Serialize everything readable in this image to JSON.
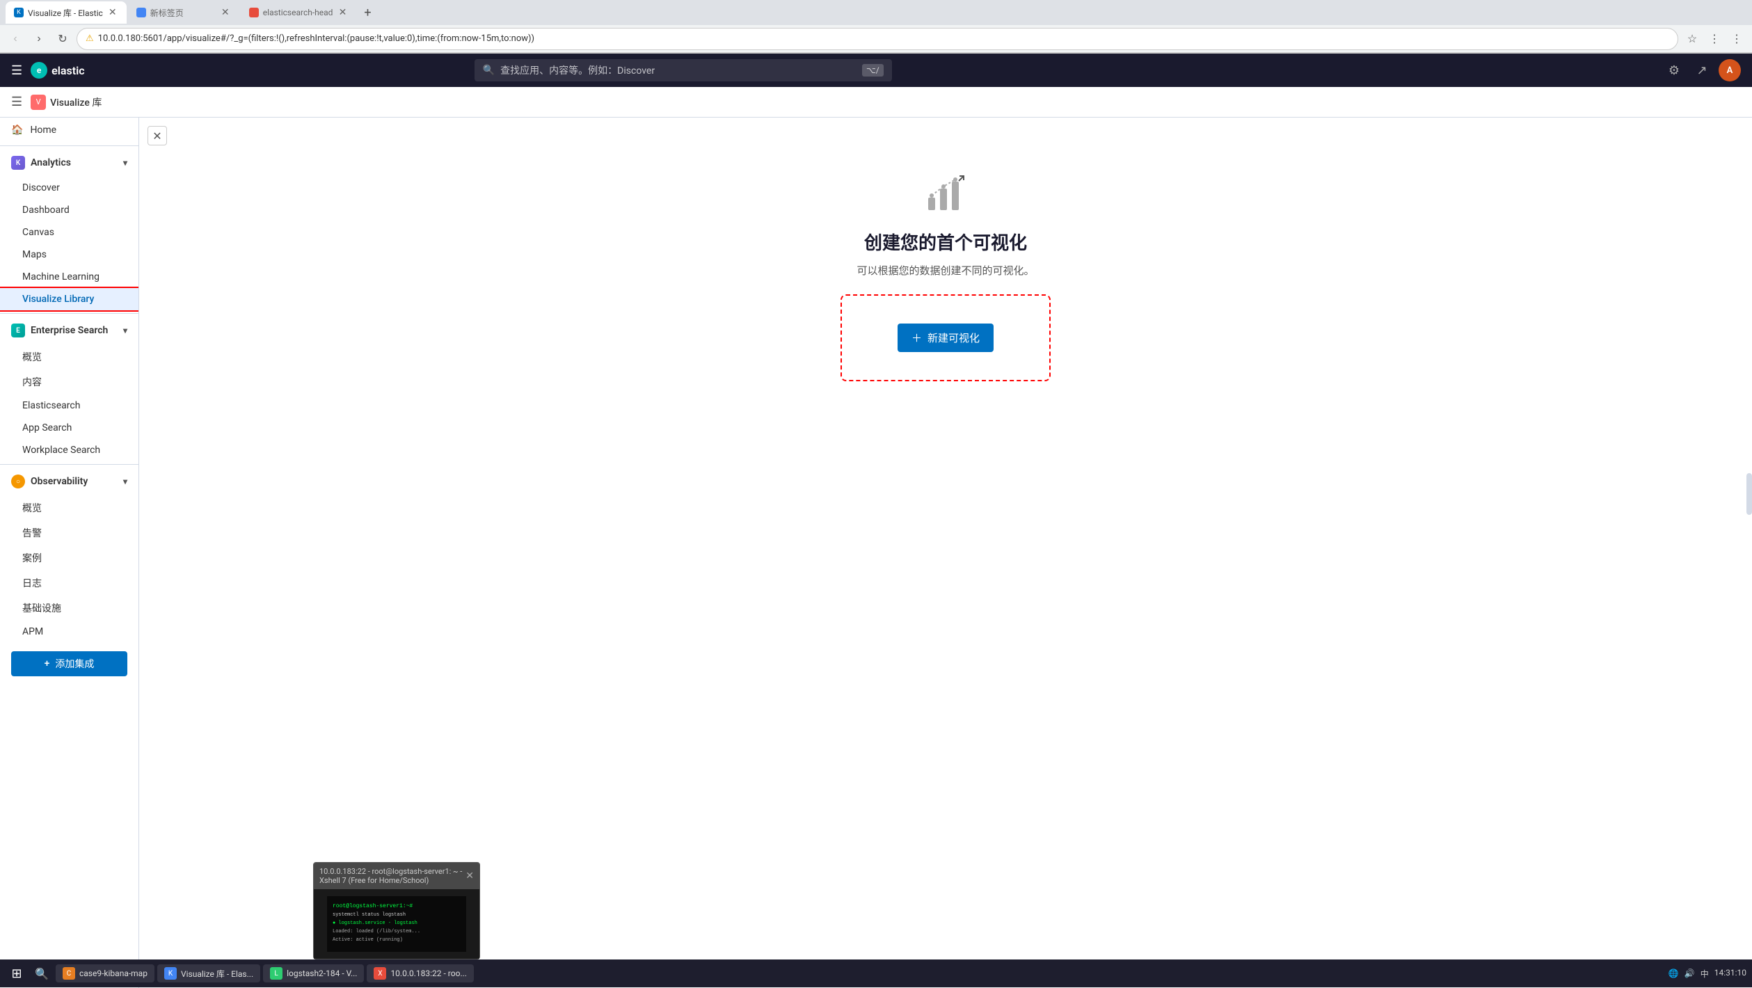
{
  "browser": {
    "tabs": [
      {
        "id": "tab1",
        "title": "Visualize 库 - Elastic",
        "favicon_color": "#0071c2",
        "active": true
      },
      {
        "id": "tab2",
        "title": "新标签页",
        "favicon_color": "#4285f4",
        "active": false
      },
      {
        "id": "tab3",
        "title": "elasticsearch-head",
        "favicon_color": "#e74c3c",
        "active": false
      }
    ],
    "url": "10.0.0.180:5601/app/visualize#/?_g=(filters:!(),refreshInterval:(pause:!t,value:0),time:(from:now-15m,to:now))",
    "url_protocol": "不安全 |"
  },
  "topnav": {
    "search_placeholder": "查找应用、内容等。例如：Discover",
    "shortcut_hint": "⌥/",
    "app_name": "elastic"
  },
  "secondaryHeader": {
    "breadcrumb": "Visualize 库"
  },
  "sidebar": {
    "home_label": "Home",
    "sections": [
      {
        "id": "analytics",
        "label": "Analytics",
        "expanded": true,
        "icon_type": "analytics",
        "items": [
          {
            "id": "discover",
            "label": "Discover",
            "active": false
          },
          {
            "id": "dashboard",
            "label": "Dashboard",
            "active": false
          },
          {
            "id": "canvas",
            "label": "Canvas",
            "active": false
          },
          {
            "id": "maps",
            "label": "Maps",
            "active": false
          },
          {
            "id": "machine-learning",
            "label": "Machine Learning",
            "active": false
          },
          {
            "id": "visualize-library",
            "label": "Visualize Library",
            "active": true
          }
        ]
      },
      {
        "id": "enterprise-search",
        "label": "Enterprise Search",
        "expanded": true,
        "icon_type": "enterprise",
        "items": [
          {
            "id": "overview",
            "label": "概览",
            "active": false
          },
          {
            "id": "content",
            "label": "内容",
            "active": false
          },
          {
            "id": "elasticsearch",
            "label": "Elasticsearch",
            "active": false
          },
          {
            "id": "app-search",
            "label": "App Search",
            "active": false
          },
          {
            "id": "workplace-search",
            "label": "Workplace Search",
            "active": false
          }
        ]
      },
      {
        "id": "observability",
        "label": "Observability",
        "expanded": true,
        "icon_type": "observability",
        "items": [
          {
            "id": "obs-overview",
            "label": "概览",
            "active": false
          },
          {
            "id": "alerts",
            "label": "告警",
            "active": false
          },
          {
            "id": "cases",
            "label": "案例",
            "active": false
          },
          {
            "id": "logs",
            "label": "日志",
            "active": false
          },
          {
            "id": "infrastructure",
            "label": "基础设施",
            "active": false
          },
          {
            "id": "apm",
            "label": "APM",
            "active": false
          }
        ]
      }
    ],
    "add_cluster_label": "添加集成"
  },
  "main": {
    "title": "创建您的首个可视化",
    "subtitle": "可以根据您的数据创建不同的可视化。",
    "create_button_label": "新建可视化"
  },
  "terminal_popup": {
    "title": "10.0.0.183:22 - root@logstash-server1: ~ - Xshell 7 (Free for Home/School)"
  },
  "taskbar": {
    "items": [
      {
        "id": "case9",
        "label": "case9-kibana-map",
        "icon_color": "#e67e22"
      },
      {
        "id": "visualize",
        "label": "Visualize 库 - Elas...",
        "icon_color": "#4285f4"
      },
      {
        "id": "logstash2",
        "label": "logstash2-184 - V...",
        "icon_color": "#2ecc71"
      },
      {
        "id": "logstash-server",
        "label": "10.0.0.183:22 - roo...",
        "icon_color": "#e74c3c"
      }
    ],
    "clock": {
      "time": "14:31:10",
      "date": "中"
    },
    "tray_icons": [
      "网络",
      "音量",
      "输入法"
    ]
  }
}
